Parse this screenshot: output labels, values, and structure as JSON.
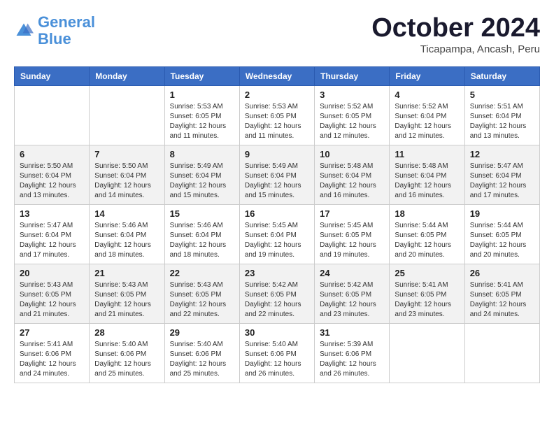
{
  "logo": {
    "line1": "General",
    "line2": "Blue"
  },
  "header": {
    "month_year": "October 2024",
    "location": "Ticapampa, Ancash, Peru"
  },
  "weekdays": [
    "Sunday",
    "Monday",
    "Tuesday",
    "Wednesday",
    "Thursday",
    "Friday",
    "Saturday"
  ],
  "weeks": [
    [
      {
        "day": "",
        "sunrise": "",
        "sunset": "",
        "daylight": ""
      },
      {
        "day": "",
        "sunrise": "",
        "sunset": "",
        "daylight": ""
      },
      {
        "day": "1",
        "sunrise": "Sunrise: 5:53 AM",
        "sunset": "Sunset: 6:05 PM",
        "daylight": "Daylight: 12 hours and 11 minutes."
      },
      {
        "day": "2",
        "sunrise": "Sunrise: 5:53 AM",
        "sunset": "Sunset: 6:05 PM",
        "daylight": "Daylight: 12 hours and 11 minutes."
      },
      {
        "day": "3",
        "sunrise": "Sunrise: 5:52 AM",
        "sunset": "Sunset: 6:05 PM",
        "daylight": "Daylight: 12 hours and 12 minutes."
      },
      {
        "day": "4",
        "sunrise": "Sunrise: 5:52 AM",
        "sunset": "Sunset: 6:04 PM",
        "daylight": "Daylight: 12 hours and 12 minutes."
      },
      {
        "day": "5",
        "sunrise": "Sunrise: 5:51 AM",
        "sunset": "Sunset: 6:04 PM",
        "daylight": "Daylight: 12 hours and 13 minutes."
      }
    ],
    [
      {
        "day": "6",
        "sunrise": "Sunrise: 5:50 AM",
        "sunset": "Sunset: 6:04 PM",
        "daylight": "Daylight: 12 hours and 13 minutes."
      },
      {
        "day": "7",
        "sunrise": "Sunrise: 5:50 AM",
        "sunset": "Sunset: 6:04 PM",
        "daylight": "Daylight: 12 hours and 14 minutes."
      },
      {
        "day": "8",
        "sunrise": "Sunrise: 5:49 AM",
        "sunset": "Sunset: 6:04 PM",
        "daylight": "Daylight: 12 hours and 15 minutes."
      },
      {
        "day": "9",
        "sunrise": "Sunrise: 5:49 AM",
        "sunset": "Sunset: 6:04 PM",
        "daylight": "Daylight: 12 hours and 15 minutes."
      },
      {
        "day": "10",
        "sunrise": "Sunrise: 5:48 AM",
        "sunset": "Sunset: 6:04 PM",
        "daylight": "Daylight: 12 hours and 16 minutes."
      },
      {
        "day": "11",
        "sunrise": "Sunrise: 5:48 AM",
        "sunset": "Sunset: 6:04 PM",
        "daylight": "Daylight: 12 hours and 16 minutes."
      },
      {
        "day": "12",
        "sunrise": "Sunrise: 5:47 AM",
        "sunset": "Sunset: 6:04 PM",
        "daylight": "Daylight: 12 hours and 17 minutes."
      }
    ],
    [
      {
        "day": "13",
        "sunrise": "Sunrise: 5:47 AM",
        "sunset": "Sunset: 6:04 PM",
        "daylight": "Daylight: 12 hours and 17 minutes."
      },
      {
        "day": "14",
        "sunrise": "Sunrise: 5:46 AM",
        "sunset": "Sunset: 6:04 PM",
        "daylight": "Daylight: 12 hours and 18 minutes."
      },
      {
        "day": "15",
        "sunrise": "Sunrise: 5:46 AM",
        "sunset": "Sunset: 6:04 PM",
        "daylight": "Daylight: 12 hours and 18 minutes."
      },
      {
        "day": "16",
        "sunrise": "Sunrise: 5:45 AM",
        "sunset": "Sunset: 6:04 PM",
        "daylight": "Daylight: 12 hours and 19 minutes."
      },
      {
        "day": "17",
        "sunrise": "Sunrise: 5:45 AM",
        "sunset": "Sunset: 6:05 PM",
        "daylight": "Daylight: 12 hours and 19 minutes."
      },
      {
        "day": "18",
        "sunrise": "Sunrise: 5:44 AM",
        "sunset": "Sunset: 6:05 PM",
        "daylight": "Daylight: 12 hours and 20 minutes."
      },
      {
        "day": "19",
        "sunrise": "Sunrise: 5:44 AM",
        "sunset": "Sunset: 6:05 PM",
        "daylight": "Daylight: 12 hours and 20 minutes."
      }
    ],
    [
      {
        "day": "20",
        "sunrise": "Sunrise: 5:43 AM",
        "sunset": "Sunset: 6:05 PM",
        "daylight": "Daylight: 12 hours and 21 minutes."
      },
      {
        "day": "21",
        "sunrise": "Sunrise: 5:43 AM",
        "sunset": "Sunset: 6:05 PM",
        "daylight": "Daylight: 12 hours and 21 minutes."
      },
      {
        "day": "22",
        "sunrise": "Sunrise: 5:43 AM",
        "sunset": "Sunset: 6:05 PM",
        "daylight": "Daylight: 12 hours and 22 minutes."
      },
      {
        "day": "23",
        "sunrise": "Sunrise: 5:42 AM",
        "sunset": "Sunset: 6:05 PM",
        "daylight": "Daylight: 12 hours and 22 minutes."
      },
      {
        "day": "24",
        "sunrise": "Sunrise: 5:42 AM",
        "sunset": "Sunset: 6:05 PM",
        "daylight": "Daylight: 12 hours and 23 minutes."
      },
      {
        "day": "25",
        "sunrise": "Sunrise: 5:41 AM",
        "sunset": "Sunset: 6:05 PM",
        "daylight": "Daylight: 12 hours and 23 minutes."
      },
      {
        "day": "26",
        "sunrise": "Sunrise: 5:41 AM",
        "sunset": "Sunset: 6:05 PM",
        "daylight": "Daylight: 12 hours and 24 minutes."
      }
    ],
    [
      {
        "day": "27",
        "sunrise": "Sunrise: 5:41 AM",
        "sunset": "Sunset: 6:06 PM",
        "daylight": "Daylight: 12 hours and 24 minutes."
      },
      {
        "day": "28",
        "sunrise": "Sunrise: 5:40 AM",
        "sunset": "Sunset: 6:06 PM",
        "daylight": "Daylight: 12 hours and 25 minutes."
      },
      {
        "day": "29",
        "sunrise": "Sunrise: 5:40 AM",
        "sunset": "Sunset: 6:06 PM",
        "daylight": "Daylight: 12 hours and 25 minutes."
      },
      {
        "day": "30",
        "sunrise": "Sunrise: 5:40 AM",
        "sunset": "Sunset: 6:06 PM",
        "daylight": "Daylight: 12 hours and 26 minutes."
      },
      {
        "day": "31",
        "sunrise": "Sunrise: 5:39 AM",
        "sunset": "Sunset: 6:06 PM",
        "daylight": "Daylight: 12 hours and 26 minutes."
      },
      {
        "day": "",
        "sunrise": "",
        "sunset": "",
        "daylight": ""
      },
      {
        "day": "",
        "sunrise": "",
        "sunset": "",
        "daylight": ""
      }
    ]
  ]
}
